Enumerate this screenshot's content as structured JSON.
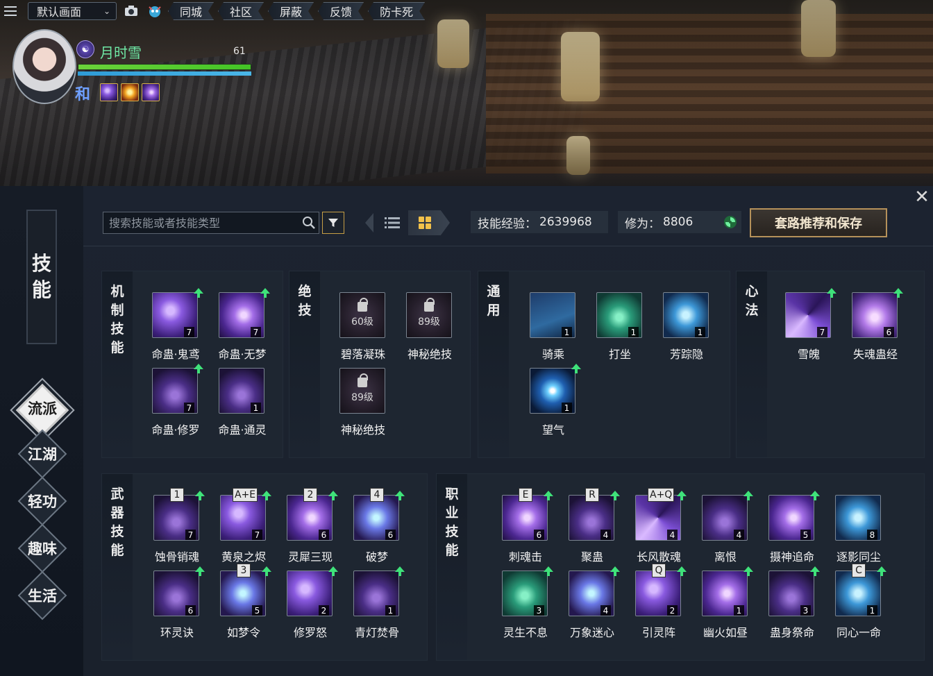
{
  "topbar": {
    "preset": "默认画面",
    "buttons": [
      "同城",
      "社区",
      "屏蔽",
      "反馈",
      "防卡死"
    ]
  },
  "player": {
    "name": "月时雪",
    "level": "61",
    "stance": "和",
    "hp_fraction": 1.0,
    "mp_fraction": 1.0
  },
  "nav": {
    "title_chars": [
      "技",
      "能"
    ],
    "items": [
      {
        "label": "流派",
        "active": true
      },
      {
        "label": "江湖",
        "active": false
      },
      {
        "label": "轻功",
        "active": false
      },
      {
        "label": "趣味",
        "active": false
      },
      {
        "label": "生活",
        "active": false
      }
    ]
  },
  "header": {
    "search_placeholder": "搜索技能或者技能类型",
    "skill_exp_label": "技能经验：",
    "skill_exp_value": "2639968",
    "cultivation_label": "修为：",
    "cultivation_value": "8806",
    "recommend_button": "套路推荐和保存"
  },
  "sections": {
    "mechanism": {
      "label_chars": [
        "机",
        "制",
        "技",
        "能"
      ],
      "skills": [
        {
          "name": "命蛊·鬼鸢",
          "level": "7",
          "up": true,
          "style": "ic-purple"
        },
        {
          "name": "命蛊·无梦",
          "level": "7",
          "up": true,
          "style": "ic-violet"
        },
        {
          "name": "命蛊·修罗",
          "level": "7",
          "up": true,
          "style": "ic-dark"
        },
        {
          "name": "命蛊·通灵",
          "level": "1",
          "up": false,
          "style": "ic-dark"
        }
      ]
    },
    "ultimate": {
      "label_chars": [
        "绝",
        "技"
      ],
      "skills": [
        {
          "name": "碧落凝珠",
          "requirement": "60级"
        },
        {
          "name": "神秘绝技",
          "requirement": "89级"
        },
        {
          "name": "神秘绝技",
          "requirement": "89级"
        }
      ]
    },
    "general": {
      "label_chars": [
        "通",
        "用"
      ],
      "skills": [
        {
          "name": "骑乘",
          "level": "1",
          "up": false,
          "style": "ic-horse"
        },
        {
          "name": "打坐",
          "level": "1",
          "up": false,
          "style": "ic-green"
        },
        {
          "name": "芳踪隐",
          "level": "1",
          "up": false,
          "style": "ic-blue"
        },
        {
          "name": "望气",
          "level": "1",
          "up": true,
          "style": "ic-eye"
        }
      ]
    },
    "mentality": {
      "label_chars": [
        "心",
        "法"
      ],
      "skills": [
        {
          "name": "雪魄",
          "level": "7",
          "up": true,
          "style": "ic-swirl"
        },
        {
          "name": "失魂蛊经",
          "level": "6",
          "up": true,
          "style": "ic-lotus"
        }
      ]
    },
    "weapon": {
      "label_chars": [
        "武",
        "器",
        "技",
        "能"
      ],
      "skills": [
        {
          "name": "蚀骨销魂",
          "level": "7",
          "up": true,
          "key": "1",
          "style": "ic-dark"
        },
        {
          "name": "黄泉之烬",
          "level": "7",
          "up": true,
          "key": "A+E",
          "style": "ic-purple"
        },
        {
          "name": "灵犀三现",
          "level": "6",
          "up": true,
          "key": "2",
          "style": "ic-violet"
        },
        {
          "name": "破梦",
          "level": "6",
          "up": true,
          "key": "4",
          "style": "ic-cyan"
        },
        {
          "name": "环灵诀",
          "level": "6",
          "up": true,
          "key": "",
          "style": "ic-dark"
        },
        {
          "name": "如梦令",
          "level": "5",
          "up": true,
          "key": "3",
          "style": "ic-cyan"
        },
        {
          "name": "修罗怒",
          "level": "2",
          "up": true,
          "key": "",
          "style": "ic-purple"
        },
        {
          "name": "青灯焚骨",
          "level": "1",
          "up": true,
          "key": "",
          "style": "ic-dark"
        }
      ]
    },
    "profession": {
      "label_chars": [
        "职",
        "业",
        "技",
        "能"
      ],
      "skills": [
        {
          "name": "刺魂击",
          "level": "6",
          "up": true,
          "key": "E",
          "style": "ic-violet"
        },
        {
          "name": "聚蛊",
          "level": "4",
          "up": true,
          "key": "R",
          "style": "ic-dark"
        },
        {
          "name": "长风散魂",
          "level": "4",
          "up": true,
          "key": "A+Q",
          "style": "ic-swirl"
        },
        {
          "name": "离恨",
          "level": "4",
          "up": true,
          "key": "",
          "style": "ic-dark"
        },
        {
          "name": "摄神追命",
          "level": "5",
          "up": true,
          "key": "",
          "style": "ic-violet"
        },
        {
          "name": "逐影同尘",
          "level": "8",
          "up": false,
          "key": "",
          "style": "ic-blue"
        },
        {
          "name": "灵生不息",
          "level": "3",
          "up": true,
          "key": "",
          "style": "ic-green"
        },
        {
          "name": "万象迷心",
          "level": "4",
          "up": true,
          "key": "",
          "style": "ic-cyan"
        },
        {
          "name": "引灵阵",
          "level": "2",
          "up": true,
          "key": "Q",
          "style": "ic-purple"
        },
        {
          "name": "幽火如昼",
          "level": "1",
          "up": true,
          "key": "",
          "style": "ic-violet"
        },
        {
          "name": "蛊身祭命",
          "level": "3",
          "up": true,
          "key": "",
          "style": "ic-dark"
        },
        {
          "name": "同心一命",
          "level": "1",
          "up": true,
          "key": "C",
          "style": "ic-blue"
        }
      ]
    }
  },
  "colors": {
    "accent_gold": "#b5915a",
    "player_name": "#6fe8a5",
    "upgrade_arrow": "#3fe27a"
  }
}
